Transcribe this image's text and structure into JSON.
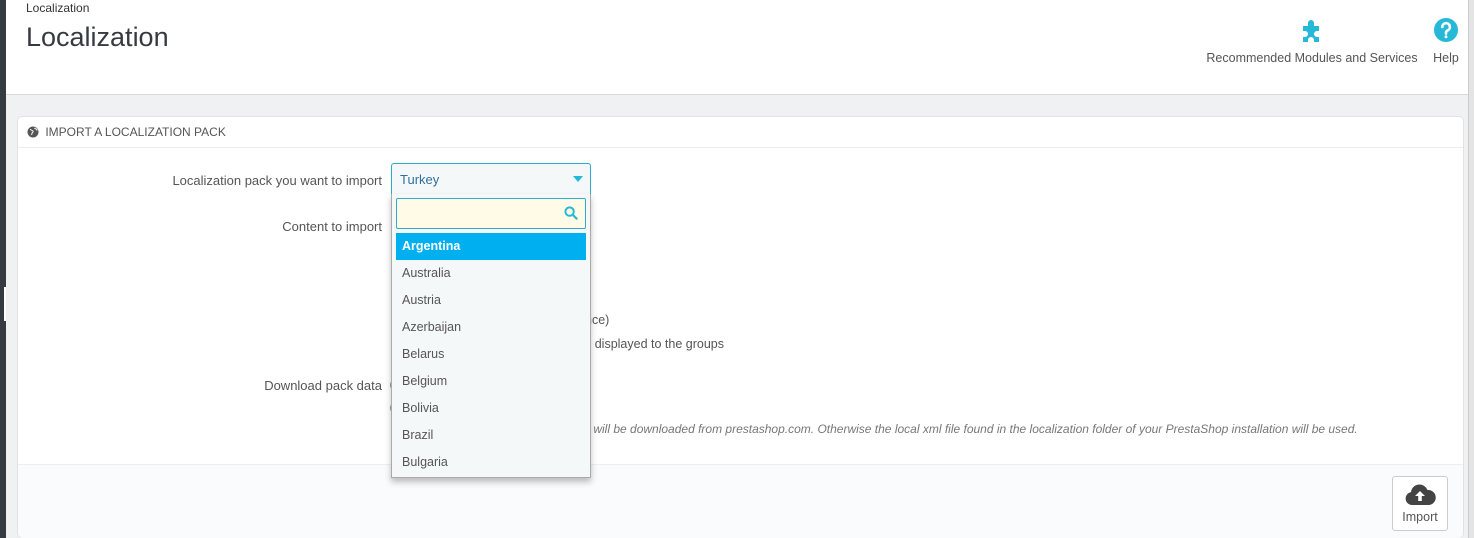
{
  "header": {
    "breadcrumb": "Localization",
    "title": "Localization",
    "toolbar": {
      "modules_label": "Recommended Modules and Services",
      "help_label": "Help"
    }
  },
  "panel": {
    "heading": "IMPORT A LOCALIZATION PACK",
    "pack_label": "Localization pack you want to import",
    "content_label": "Content to import",
    "download_label": "Download pack data",
    "partial_text_1": "nce)",
    "partial_text_2": "s displayed to the groups",
    "help_text": "ck will be downloaded from prestashop.com. Otherwise the local xml file found in the localization folder of your PrestaShop installation will be used.",
    "import_label": "Import"
  },
  "select": {
    "selected": "Turkey",
    "search_placeholder": "",
    "options": [
      "Argentina",
      "Australia",
      "Austria",
      "Azerbaijan",
      "Belarus",
      "Belgium",
      "Bolivia",
      "Brazil",
      "Bulgaria"
    ],
    "highlighted": "Argentina"
  },
  "colors": {
    "accent": "#25b9d7",
    "highlight": "#00aff0",
    "sidebar": "#363a41"
  }
}
